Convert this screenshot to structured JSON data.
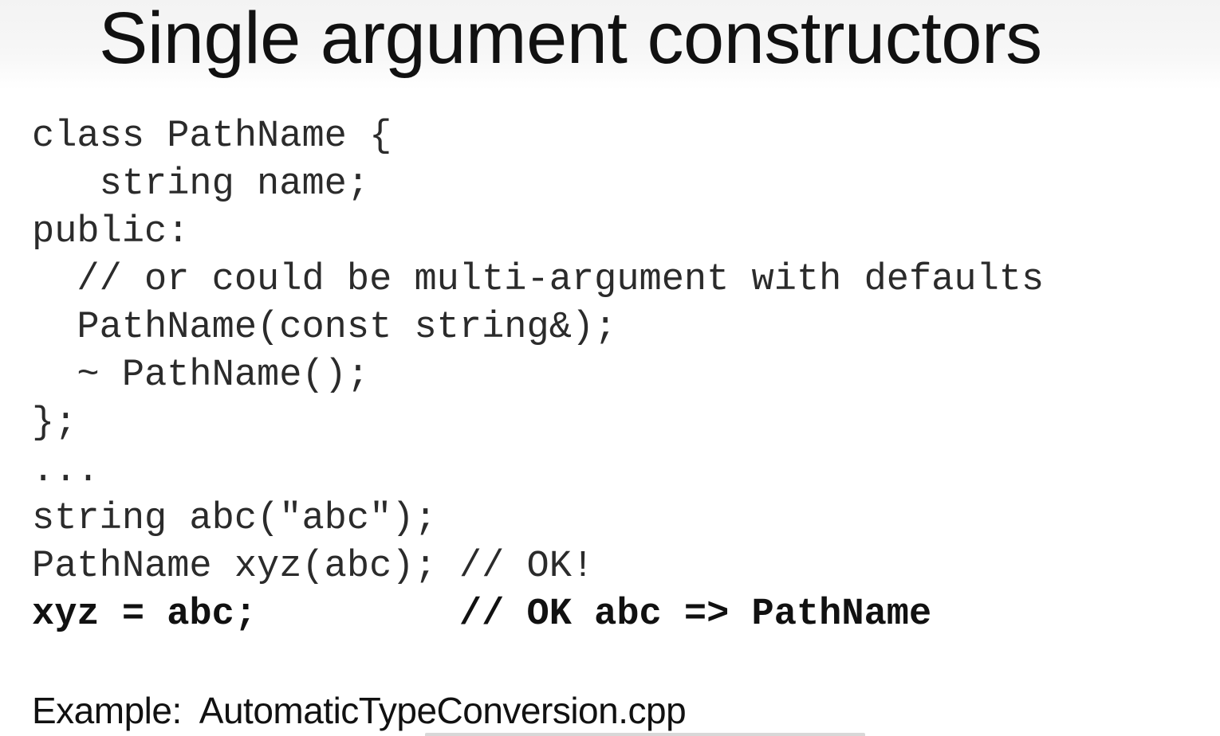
{
  "slide": {
    "title": "Single argument constructors",
    "code_lines": [
      {
        "text": "class PathName {",
        "bold": false
      },
      {
        "text": "   string name;",
        "bold": false
      },
      {
        "text": "public:",
        "bold": false
      },
      {
        "text": "  // or could be multi-argument with defaults",
        "bold": false
      },
      {
        "text": "  PathName(const string&);",
        "bold": false
      },
      {
        "text": "  ~ PathName();",
        "bold": false
      },
      {
        "text": "};",
        "bold": false
      },
      {
        "text": "...",
        "bold": false
      },
      {
        "text": "string abc(\"abc\");",
        "bold": false
      },
      {
        "text": "PathName xyz(abc); // OK!",
        "bold": false
      },
      {
        "text": "xyz = abc;         // OK abc => PathName",
        "bold": true
      }
    ],
    "example_label": "Example:  AutomaticTypeConversion.cpp"
  }
}
